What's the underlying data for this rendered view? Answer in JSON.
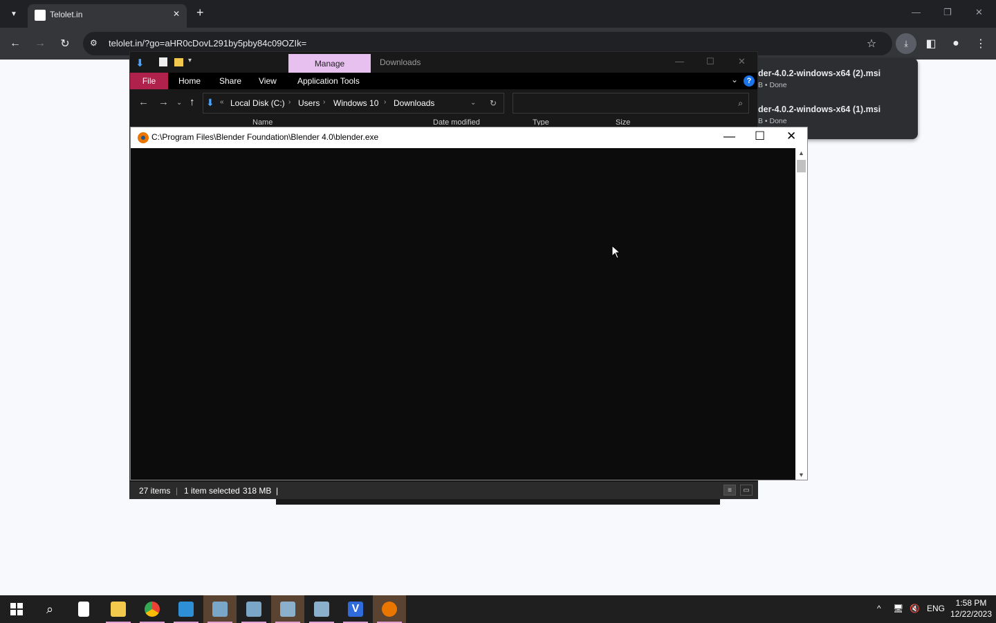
{
  "browser": {
    "tab_title": "Telolet.in",
    "url": "telolet.in/?go=aHR0cDovL291by5pby84c09OZIk=",
    "downloads": [
      {
        "name": "der-4.0.2-windows-x64 (2).msi",
        "status": "B • Done"
      },
      {
        "name": "der-4.0.2-windows-x64 (1).msi",
        "status": "B • Done"
      }
    ]
  },
  "explorer": {
    "context_tab": "Manage",
    "window_title": "Downloads",
    "ribbon_tabs": [
      "File",
      "Home",
      "Share",
      "View",
      "Application Tools"
    ],
    "breadcrumb": [
      "Local Disk (C:)",
      "Users",
      "Windows 10",
      "Downloads"
    ],
    "columns": [
      "Name",
      "Date modified",
      "Type",
      "Size"
    ],
    "status": {
      "items": "27 items",
      "selected": "1 item selected",
      "size": "318 MB"
    }
  },
  "console": {
    "title": "C:\\Program Files\\Blender Foundation\\Blender 4.0\\blender.exe"
  },
  "taskbar": {
    "clock_time": "1:58 PM",
    "clock_date": "12/22/2023",
    "language": "ENG",
    "apps": [
      "start",
      "search",
      "notepad",
      "file-explorer",
      "chrome",
      "visual-studio",
      "installer-1",
      "installer-2",
      "installer-3",
      "installer-4",
      "v-app",
      "blender"
    ]
  },
  "colors": {
    "accent_file_tab": "#b0214b",
    "manage_tab": "#e8c0f0",
    "blender_orange": "#ea7600"
  }
}
